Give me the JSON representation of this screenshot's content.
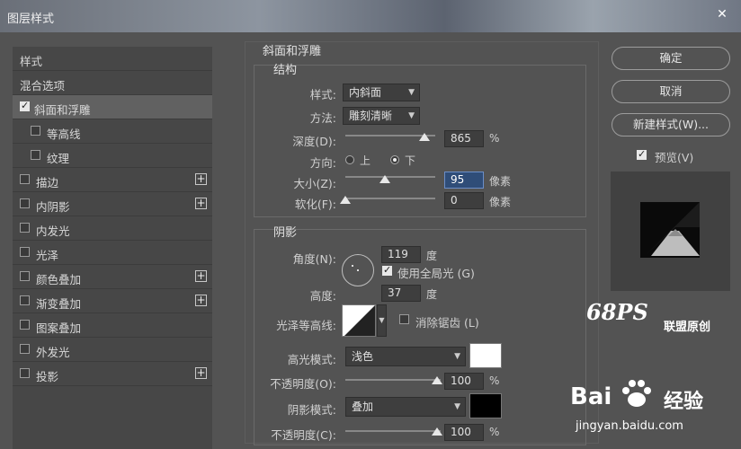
{
  "window": {
    "title": "图层样式",
    "close_icon": "close-icon"
  },
  "left_panel": {
    "items": [
      {
        "label": "样式"
      },
      {
        "label": "混合选项"
      },
      {
        "label": "斜面和浮雕",
        "checked": true
      },
      {
        "label": "等高线",
        "checked": false
      },
      {
        "label": "纹理",
        "checked": false
      },
      {
        "label": "描边",
        "checked": false,
        "plus": true
      },
      {
        "label": "内阴影",
        "checked": false,
        "plus": true
      },
      {
        "label": "内发光",
        "checked": false
      },
      {
        "label": "光泽",
        "checked": false
      },
      {
        "label": "颜色叠加",
        "checked": false,
        "plus": true
      },
      {
        "label": "渐变叠加",
        "checked": false,
        "plus": true
      },
      {
        "label": "图案叠加",
        "checked": false
      },
      {
        "label": "外发光",
        "checked": false
      },
      {
        "label": "投影",
        "checked": false,
        "plus": true
      }
    ]
  },
  "buttons": {
    "ok": "确定",
    "cancel": "取消",
    "new_style": "新建样式(W)...",
    "preview_label": "预览(V)",
    "preview_checked": true
  },
  "bevel": {
    "section_title": "斜面和浮雕",
    "structure_title": "结构",
    "style_label": "样式:",
    "style_value": "内斜面",
    "method_label": "方法:",
    "method_value": "雕刻清晰",
    "depth_label": "深度(D):",
    "depth_value": "865",
    "depth_unit": "%",
    "direction_label": "方向:",
    "direction_up": "上",
    "direction_down": "下",
    "size_label": "大小(Z):",
    "size_value": "95",
    "size_unit": "像素",
    "soften_label": "软化(F):",
    "soften_value": "0",
    "soften_unit": "像素"
  },
  "shading": {
    "title": "阴影",
    "angle_label": "角度(N):",
    "angle_value": "119",
    "angle_unit": "度",
    "global_light_label": "使用全局光 (G)",
    "global_light_checked": true,
    "altitude_label": "高度:",
    "altitude_value": "37",
    "altitude_unit": "度",
    "gloss_contour_label": "光泽等高线:",
    "antialias_label": "消除锯齿 (L)",
    "antialias_checked": false,
    "highlight_mode_label": "高光模式:",
    "highlight_mode_value": "浅色",
    "highlight_color": "#ffffff",
    "highlight_opacity_label": "不透明度(O):",
    "highlight_opacity_value": "100",
    "highlight_opacity_unit": "%",
    "shadow_mode_label": "阴影模式:",
    "shadow_mode_value": "叠加",
    "shadow_color": "#000000",
    "shadow_opacity_label": "不透明度(C):",
    "shadow_opacity_value": "100",
    "shadow_opacity_unit": "%"
  },
  "watermarks": {
    "logo": "68PS",
    "logo_text": "联盟原创",
    "baidu_brand": "Bai",
    "baidu_jingyan": "经验",
    "baidu_url": "jingyan.baidu.com"
  }
}
